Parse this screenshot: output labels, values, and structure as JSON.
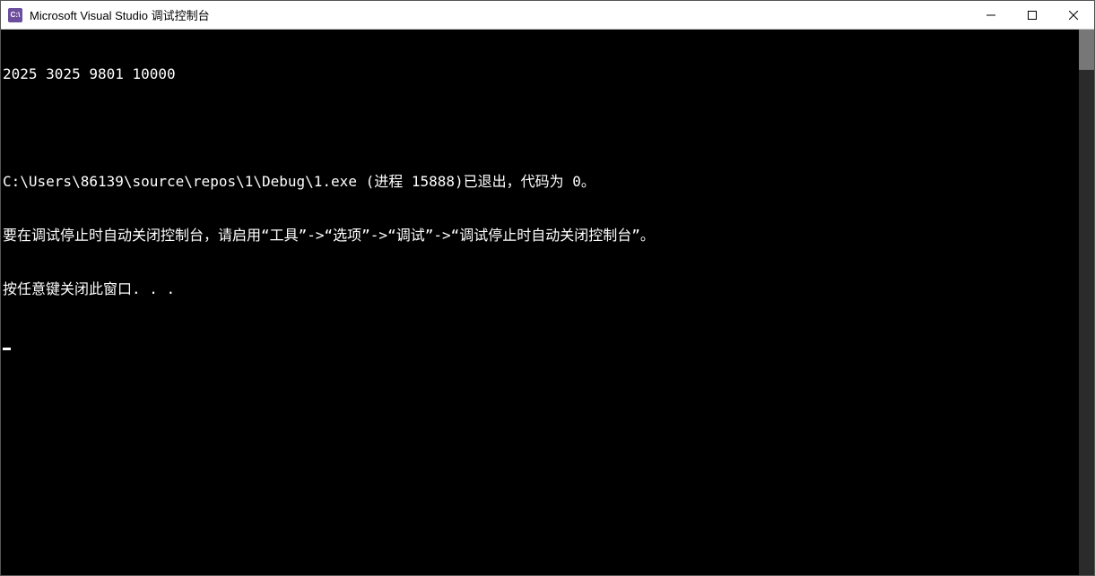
{
  "window": {
    "title": "Microsoft Visual Studio 调试控制台",
    "icon_label": "C:\\"
  },
  "console": {
    "lines": [
      "2025 3025 9801 10000",
      "",
      "C:\\Users\\86139\\source\\repos\\1\\Debug\\1.exe (进程 15888)已退出，代码为 0。",
      "要在调试停止时自动关闭控制台，请启用“工具”->“选项”->“调试”->“调试停止时自动关闭控制台”。",
      "按任意键关闭此窗口. . ."
    ]
  }
}
